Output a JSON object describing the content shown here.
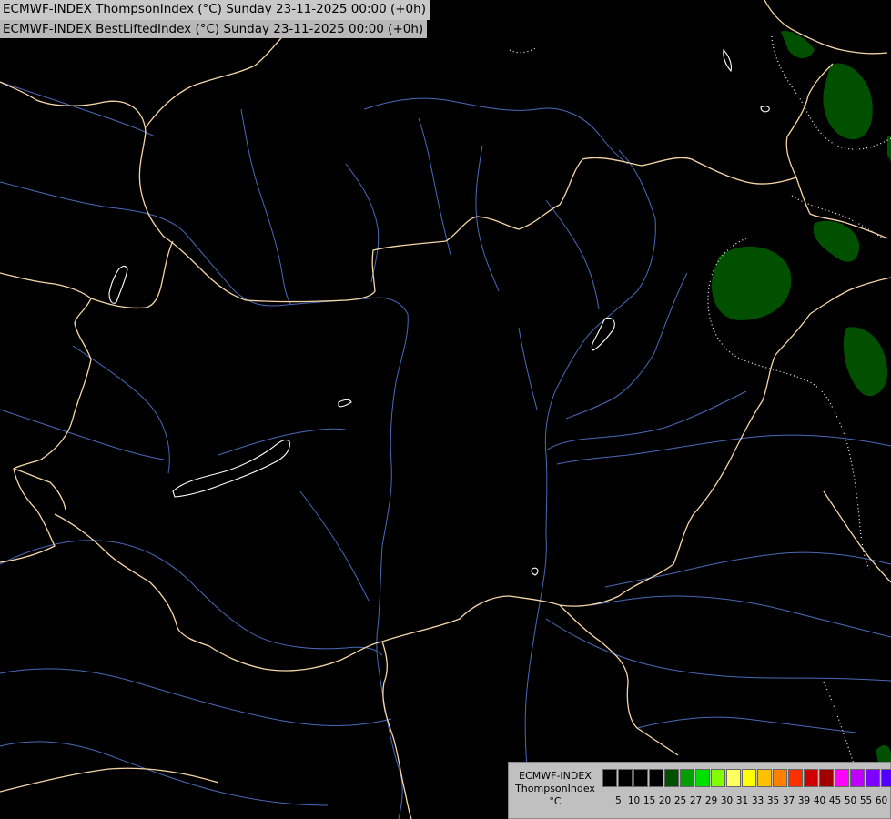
{
  "titles": {
    "line1": "ECMWF-INDEX ThompsonIndex (°C) Sunday 23-11-2025 00:00 (+0h)",
    "line2": "ECMWF-INDEX BestLiftedIndex (°C) Sunday 23-11-2025 00:00 (+0h)"
  },
  "legend": {
    "model": "ECMWF-INDEX",
    "parameter": "ThompsonIndex",
    "unit": "°C",
    "swatches": [
      "#000000",
      "#000000",
      "#000000",
      "#000000",
      "#005000",
      "#00a000",
      "#00e000",
      "#80ff00",
      "#ffff60",
      "#ffff00",
      "#ffc000",
      "#ff8000",
      "#ff3000",
      "#d00000",
      "#a00000",
      "#ff00ff",
      "#c000ff",
      "#8000ff",
      "#5000ff",
      "#0000ff"
    ],
    "ticks": [
      "5",
      "10",
      "15",
      "20",
      "25",
      "27",
      "29",
      "30",
      "31",
      "33",
      "35",
      "37",
      "39",
      "40",
      "45",
      "50",
      "55",
      "60"
    ]
  },
  "colors": {
    "background": "#000000",
    "border": "#f5d6a6",
    "river": "#4a6ab8",
    "lake": "#ffffff",
    "field": "#005000",
    "bli_contour": "#ffffff"
  }
}
